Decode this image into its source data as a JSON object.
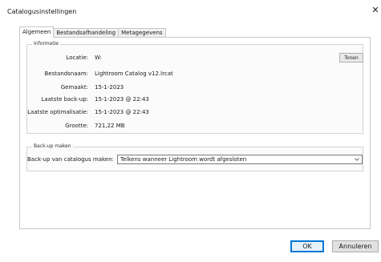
{
  "window": {
    "title": "Catalogusinstellingen"
  },
  "tabs": [
    {
      "label": "Algemeen",
      "active": true
    },
    {
      "label": "Bestandsafhandeling",
      "active": false
    },
    {
      "label": "Metagegevens",
      "active": false
    }
  ],
  "info": {
    "group_label": "Informatie",
    "rows": [
      {
        "label": "Locatie:",
        "value": "W:"
      },
      {
        "label": "Bestandsnaam:",
        "value": "Lightroom Catalog v12.lrcat"
      },
      {
        "label": "Gemaakt:",
        "value": "15-1-2023"
      },
      {
        "label": "Laatste back-up:",
        "value": "15-1-2023 @ 22:43"
      },
      {
        "label": "Laatste optimalisatie:",
        "value": "15-1-2023 @ 22:43"
      },
      {
        "label": "Grootte:",
        "value": "721,22 MB"
      }
    ],
    "show_button": "Tonen"
  },
  "backup": {
    "group_label": "Back-up maken",
    "select_label": "Back-up van catalogus maken:",
    "select_value": "Telkens wanneer Lightroom wordt afgesloten"
  },
  "footer": {
    "ok_label": "OK",
    "cancel_label": "Annuleren"
  },
  "icons": {
    "close": "close-icon",
    "dropdown": "chevron-down-icon"
  }
}
